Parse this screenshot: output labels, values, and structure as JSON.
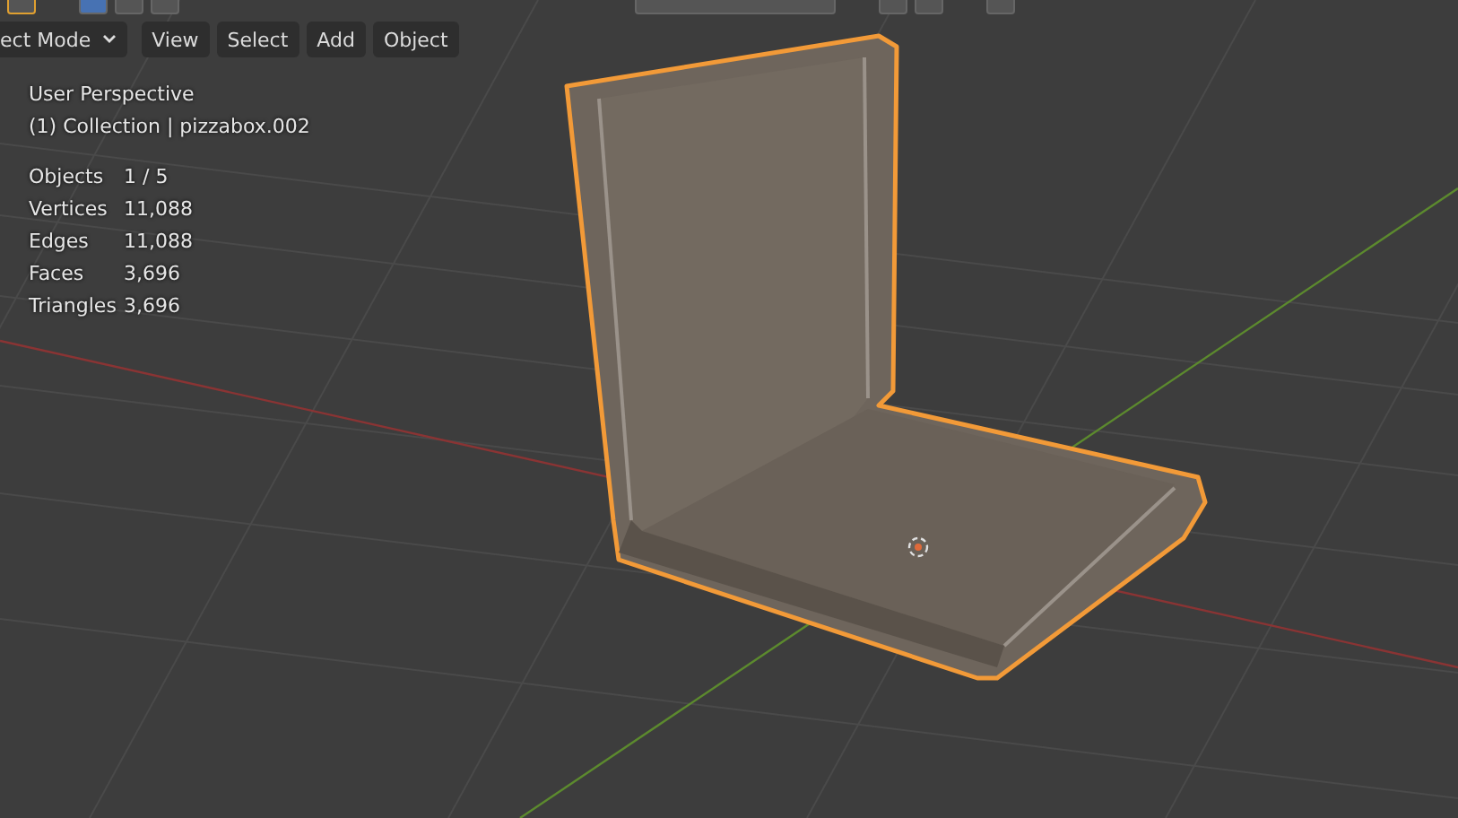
{
  "header": {
    "mode_dropdown": "ect Mode",
    "menus": [
      "View",
      "Select",
      "Add",
      "Object"
    ]
  },
  "overlay": {
    "view_name": "User Perspective",
    "collection": "(1) Collection | pizzabox.002",
    "stats": [
      {
        "label": "Objects",
        "value": "1 / 5"
      },
      {
        "label": "Vertices",
        "value": "11,088"
      },
      {
        "label": "Edges",
        "value": "11,088"
      },
      {
        "label": "Faces",
        "value": "3,696"
      },
      {
        "label": "Triangles",
        "value": "3,696"
      }
    ]
  }
}
